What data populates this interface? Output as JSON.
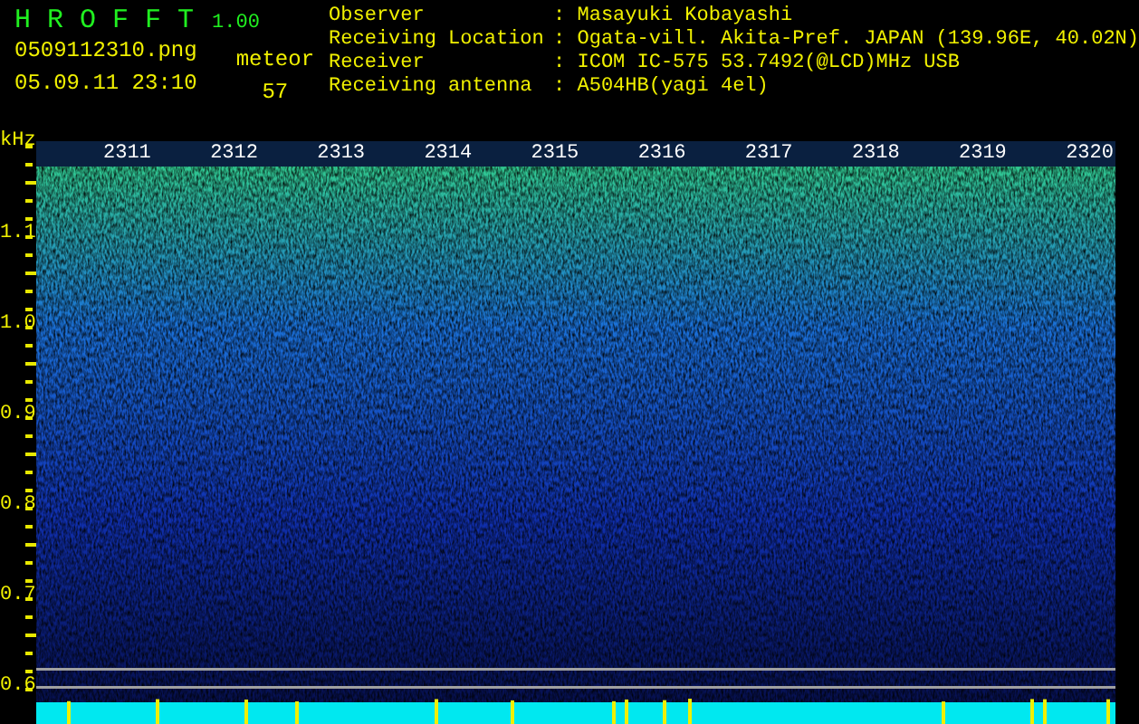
{
  "app": {
    "title": "H R O F F T",
    "version": "1.00",
    "filename": "0509112310.png",
    "datetime": "05.09.11 23:10",
    "meteor_label": "meteor",
    "meteor_count": "57"
  },
  "info": [
    {
      "label": "Observer",
      "value": ": Masayuki Kobayashi"
    },
    {
      "label": "Receiving Location",
      "value": ": Ogata-vill. Akita-Pref. JAPAN (139.96E, 40.02N)"
    },
    {
      "label": "Receiver",
      "value": ": ICOM IC-575 53.7492(@LCD)MHz USB"
    },
    {
      "label": "Receiving antenna",
      "value": ": A504HB(yagi 4el)"
    }
  ],
  "plot": {
    "unit": "kHz",
    "y_labels": [
      "1.1",
      "1.0",
      "0.9",
      "0.8",
      "0.7",
      "0.6"
    ],
    "time_labels": [
      "2311",
      "2312",
      "2313",
      "2314",
      "2315",
      "2316",
      "2317",
      "2318",
      "2319",
      "2320"
    ]
  }
}
